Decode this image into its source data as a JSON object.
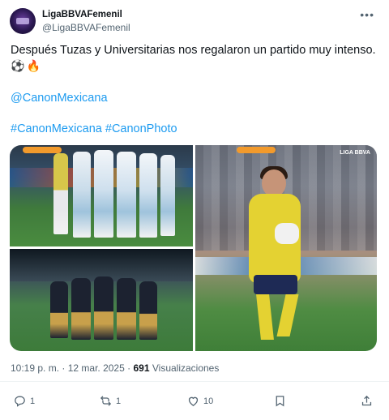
{
  "author": {
    "display_name": "LigaBBVAFemenil",
    "handle": "@LigaBBVAFemenil"
  },
  "tweet": {
    "text_line1": "Después Tuzas y Universitarias nos regalaron un partido muy intenso.",
    "emoji1": "⚽️",
    "emoji2": "🔥",
    "mention": "@CanonMexicana",
    "hashtag1": "#CanonMexicana",
    "hashtag2": "#CanonPhoto"
  },
  "media": {
    "watermark": "LIGA BBVA"
  },
  "meta": {
    "time": "10:19 p. m.",
    "separator": "·",
    "date": "12 mar. 2025",
    "views_count": "691",
    "views_label": "Visualizaciones"
  },
  "actions": {
    "reply_count": "1",
    "repost_count": "1",
    "like_count": "10"
  },
  "icons": {
    "more": "more-horizontal-icon",
    "reply": "reply-icon",
    "repost": "repost-icon",
    "like": "heart-icon",
    "bookmark": "bookmark-icon",
    "share": "share-icon"
  },
  "colors": {
    "link": "#1d9bf0",
    "text": "#0f1419",
    "muted": "#536471",
    "accent": "#f29a2c"
  }
}
